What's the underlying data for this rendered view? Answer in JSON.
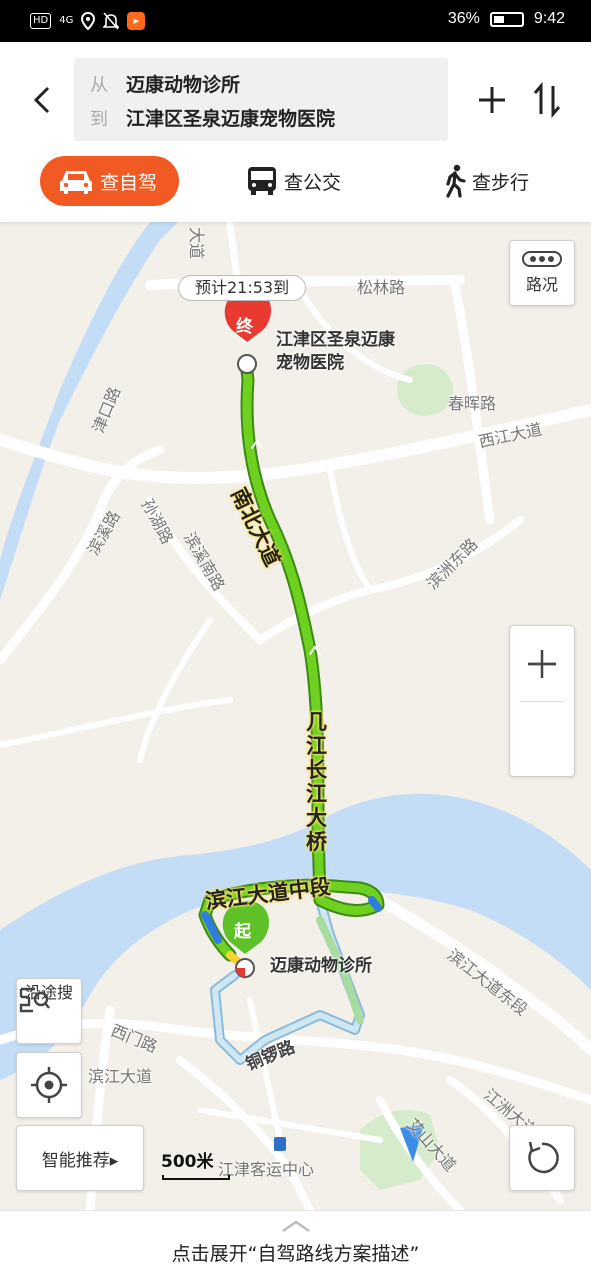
{
  "status_bar": {
    "left_icons": [
      "HD",
      "4G",
      "location-icon",
      "mute-icon",
      "app-icon"
    ],
    "battery": "36%",
    "time": "9:42"
  },
  "header": {
    "from_label": "从",
    "from_value": "迈康动物诊所",
    "to_label": "到",
    "to_value": "江津区圣泉迈康宠物医院",
    "modes": [
      {
        "label": "查自驾",
        "icon": "car-icon",
        "active": true
      },
      {
        "label": "查公交",
        "icon": "bus-icon",
        "active": false
      },
      {
        "label": "查步行",
        "icon": "walk-icon",
        "active": false
      }
    ]
  },
  "map": {
    "eta": "预计21:53到",
    "end_marker": "终",
    "start_marker": "起",
    "end_poi": [
      "江津区圣泉迈康",
      "宠物医院"
    ],
    "start_poi": "迈康动物诊所",
    "route_roads": [
      "南北大道",
      "几江长江大桥",
      "滨江大道中段",
      "铜锣路"
    ],
    "roads": [
      "松林路",
      "西江大道",
      "春晖路",
      "滨洲东路",
      "孙湖路",
      "滨溪南路",
      "滨溪路",
      "津口路",
      "滨江大道东段",
      "西门路",
      "滨江大道",
      "江洲大道",
      "艾山大道",
      "大道"
    ],
    "poi": "江津客运中心",
    "scale": "500米",
    "traffic_label": "路况",
    "along_label": "沿途搜",
    "smart_label": "智能推荐▸",
    "colors": {
      "route_green": "#6fd11f",
      "route_alt": "#a6dca0",
      "water": "#c3ddf6",
      "accent": "#f25a24"
    }
  },
  "footer": {
    "text": "点击展开“自驾路线方案描述”"
  }
}
